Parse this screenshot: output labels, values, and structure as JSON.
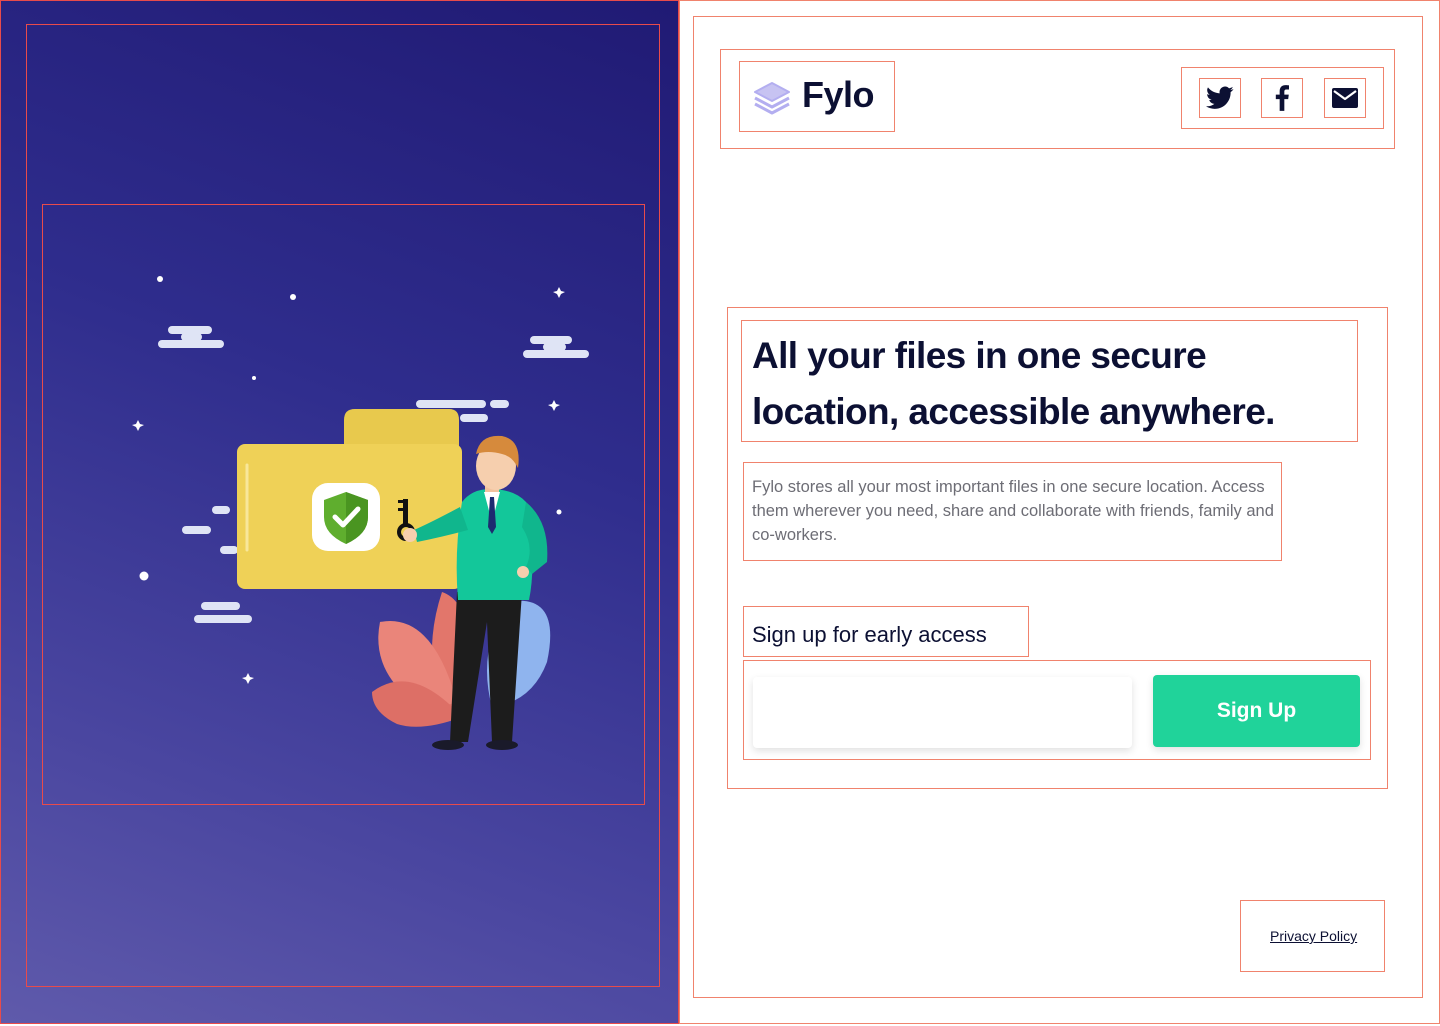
{
  "brand": {
    "name": "Fylo",
    "logo_icon": "stacked-layers-icon",
    "colors": {
      "navy": "#0c1033",
      "accent_green": "#20d39a",
      "panel_gradient_start": "#201a74",
      "panel_gradient_end": "#5f5aab"
    }
  },
  "illustration": {
    "icons": [
      "folder-icon",
      "shield-check-icon",
      "key-icon",
      "person-icon",
      "cloud-icon",
      "star-icon",
      "leaf-icon"
    ]
  },
  "social": [
    {
      "name": "twitter",
      "icon": "twitter-icon"
    },
    {
      "name": "facebook",
      "icon": "facebook-icon"
    },
    {
      "name": "email",
      "icon": "email-icon"
    }
  ],
  "hero": {
    "headline": "All your files in one secure location, accessible anywhere.",
    "description": "Fylo stores all your most important files in one secure location. Access them wherever you need, share and collaborate with friends, family and co-workers."
  },
  "signup": {
    "label": "Sign up for early access",
    "email_value": "",
    "email_placeholder": "",
    "button_label": "Sign Up"
  },
  "footer": {
    "privacy_label": "Privacy Policy"
  }
}
